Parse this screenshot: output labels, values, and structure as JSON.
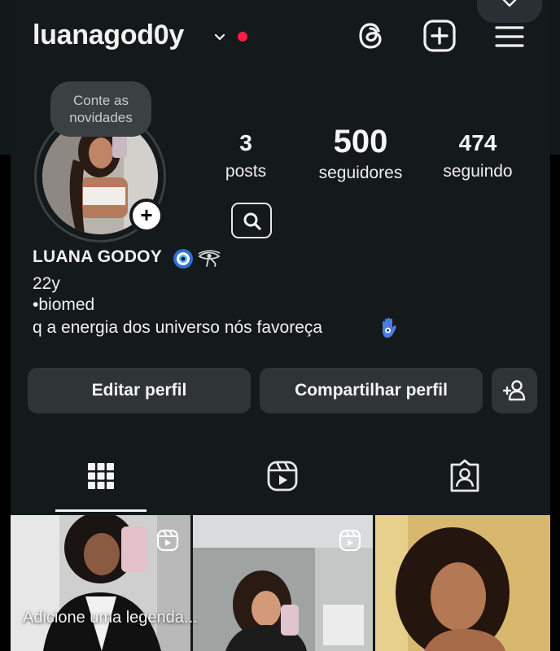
{
  "header": {
    "username": "luanagod0y",
    "icons": [
      "chevron-down-icon",
      "notification-dot",
      "threads-icon",
      "create-plus-icon",
      "menu-icon"
    ]
  },
  "profile": {
    "note_text": "Conte as novidades",
    "add_story": "+",
    "stats": [
      {
        "value": "3",
        "label": "posts"
      },
      {
        "value": "500",
        "label": "seguidores"
      },
      {
        "value": "474",
        "label": "seguindo"
      }
    ],
    "full_name": "LUANA GODOY",
    "bio_lines": [
      "22y",
      "•biomed",
      "q a energia dos universo nós favoreça"
    ]
  },
  "actions": {
    "edit_label": "Editar perfil",
    "share_label": "Compartilhar perfil"
  },
  "tabs": [
    "grid-icon",
    "reels-icon",
    "tagged-icon"
  ],
  "grid": {
    "caption": "Adicione uma legenda..."
  },
  "colors": {
    "background": "#14191b",
    "button": "#2f3437",
    "notification_dot": "#ff1f44"
  }
}
